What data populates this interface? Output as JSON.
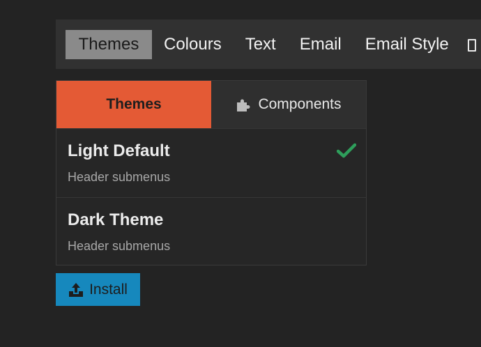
{
  "top_tabs": [
    {
      "label": "Themes",
      "active": true
    },
    {
      "label": "Colours",
      "active": false
    },
    {
      "label": "Text",
      "active": false
    },
    {
      "label": "Email",
      "active": false
    },
    {
      "label": "Email Style",
      "active": false
    }
  ],
  "panel": {
    "tabs": [
      {
        "label": "Themes",
        "active": true
      },
      {
        "label": "Components",
        "icon": "puzzle-icon",
        "active": false
      }
    ],
    "themes": [
      {
        "name": "Light Default",
        "description": "Header submenus",
        "selected": true,
        "status_icon": "check-icon"
      },
      {
        "name": "Dark Theme",
        "description": "Header submenus",
        "selected": false
      }
    ]
  },
  "install_button": {
    "label": "Install",
    "icon": "upload-icon"
  },
  "colors": {
    "background": "#232323",
    "topbar": "#313131",
    "active_top_tab": "#8a8a8a",
    "accent_orange": "#e45a35",
    "check_green": "#2e9e5b",
    "install_blue": "#1688bd"
  }
}
